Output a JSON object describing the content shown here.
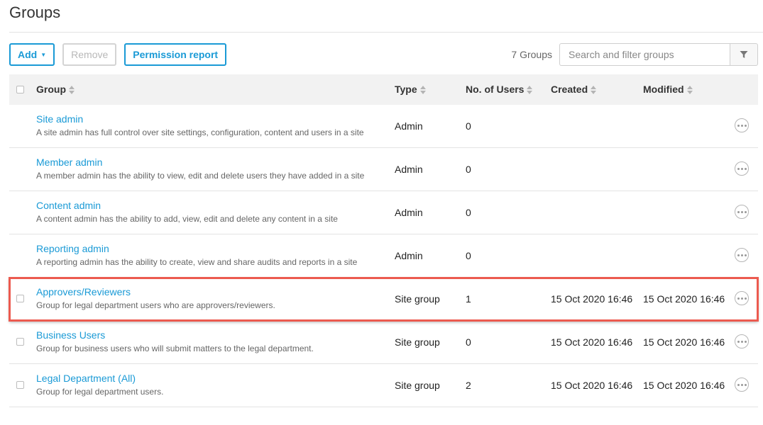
{
  "page": {
    "title": "Groups"
  },
  "toolbar": {
    "add_label": "Add",
    "remove_label": "Remove",
    "permission_report_label": "Permission report",
    "group_count": "7 Groups",
    "search_placeholder": "Search and filter groups"
  },
  "table": {
    "headers": {
      "group": "Group",
      "type": "Type",
      "users": "No. of Users",
      "created": "Created",
      "modified": "Modified"
    },
    "rows": [
      {
        "name": "Site admin",
        "description": "A site admin has full control over site settings, configuration, content and users in a site",
        "type": "Admin",
        "users": "0",
        "created": "",
        "modified": "",
        "selectable": false,
        "highlighted": false
      },
      {
        "name": "Member admin",
        "description": "A member admin has the ability to view, edit and delete users they have added in a site",
        "type": "Admin",
        "users": "0",
        "created": "",
        "modified": "",
        "selectable": false,
        "highlighted": false
      },
      {
        "name": "Content admin",
        "description": "A content admin has the ability to add, view, edit and delete any content in a site",
        "type": "Admin",
        "users": "0",
        "created": "",
        "modified": "",
        "selectable": false,
        "highlighted": false
      },
      {
        "name": "Reporting admin",
        "description": "A reporting admin has the ability to create, view and share audits and reports in a site",
        "type": "Admin",
        "users": "0",
        "created": "",
        "modified": "",
        "selectable": false,
        "highlighted": false
      },
      {
        "name": "Approvers/Reviewers",
        "description": "Group for legal department users who are approvers/reviewers.",
        "type": "Site group",
        "users": "1",
        "created": "15 Oct 2020 16:46",
        "modified": "15 Oct 2020 16:46",
        "selectable": true,
        "highlighted": true
      },
      {
        "name": "Business Users",
        "description": "Group for business users who will submit matters to the legal department.",
        "type": "Site group",
        "users": "0",
        "created": "15 Oct 2020 16:46",
        "modified": "15 Oct 2020 16:46",
        "selectable": true,
        "highlighted": false
      },
      {
        "name": "Legal Department (All)",
        "description": "Group for legal department users.",
        "type": "Site group",
        "users": "2",
        "created": "15 Oct 2020 16:46",
        "modified": "15 Oct 2020 16:46",
        "selectable": true,
        "highlighted": false
      }
    ]
  },
  "colors": {
    "accent": "#1a9ad6",
    "highlight": "#ec5a4f"
  },
  "icons": {
    "filter": "filter-icon",
    "more": "more-options-icon",
    "sort": "sort-icon"
  }
}
